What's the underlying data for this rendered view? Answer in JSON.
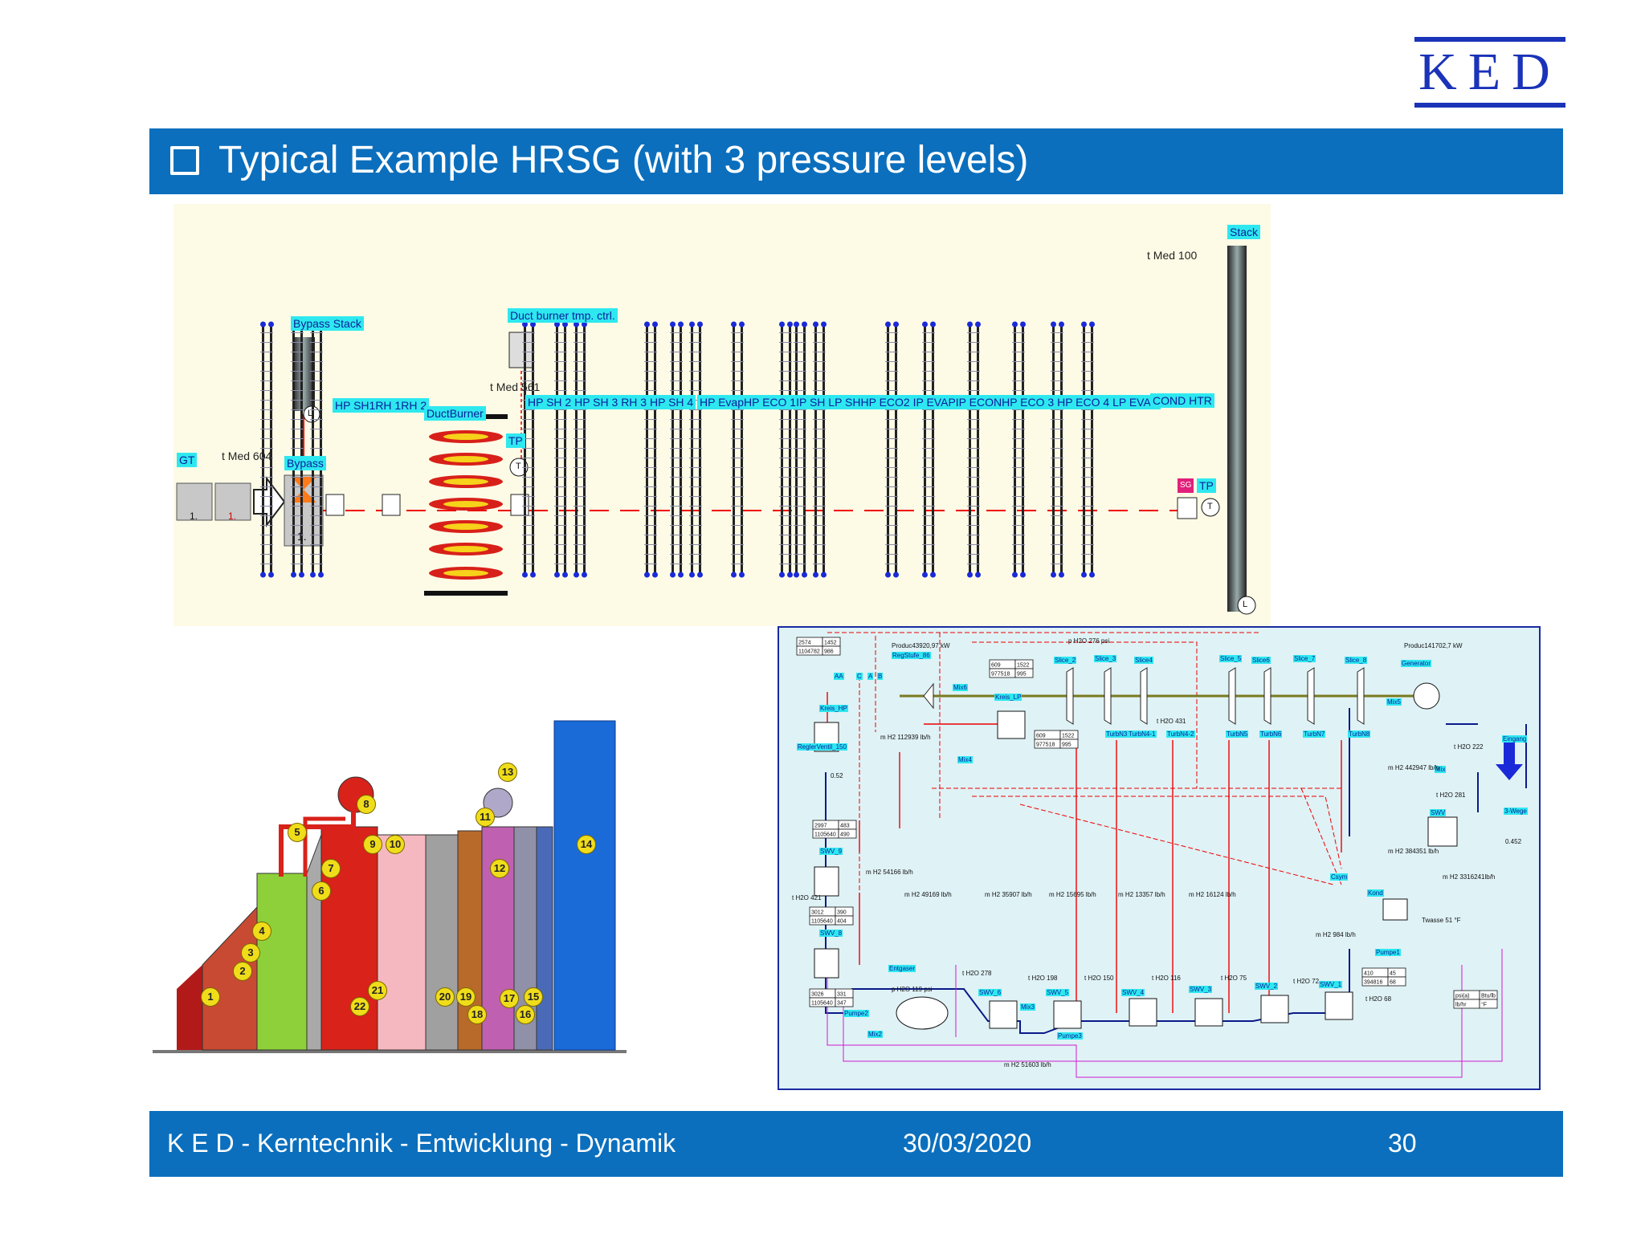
{
  "logo": {
    "text": "KED",
    "color": "#1a33b8"
  },
  "title": {
    "text": "Typical Example HRSG (with 3 pressure levels)",
    "icon": "checkbox-icon"
  },
  "footer": {
    "left": "K E D - Kerntechnik - Entwicklung - Dynamik",
    "date": "30/03/2020",
    "page": "30"
  },
  "colors": {
    "brand_blue": "#0b6fbd",
    "label_cyan": "#2ee8f0",
    "panel_bg": "#fdfbe6",
    "scheme_bg": "#dff2f6"
  },
  "hrsg": {
    "gt": "GT",
    "bypass_stack": "Bypass Stack",
    "bypass": "Bypass",
    "stack": "Stack",
    "duct_burner_ctrl": "Duct burner tmp. ctrl.",
    "duct_burner": "DuctBurner",
    "t_inlet": "t Med  604",
    "t_duct": "t Med   561",
    "t_stack": "t Med   100",
    "sections_a": "HP SH1RH 1RH 2",
    "sections_b": "HP SH 2 HP SH 3 RH 3 HP SH 4",
    "sections_c": "HP EvapHP ECO 1IP SH  LP SHHP ECO2 IP EVAPIP ECONHP ECO 3 HP ECO 4 LP EVAP",
    "cond_htr": "COND HTR",
    "tp1": "TP",
    "tp2": "TP",
    "level_l": "L",
    "t_symbol": "T",
    "gt_labels": [
      "1.",
      "1.",
      "1."
    ],
    "sg": "SG"
  },
  "boiler": {
    "numbers": [
      "1",
      "2",
      "3",
      "4",
      "5",
      "6",
      "7",
      "8",
      "9",
      "10",
      "11",
      "12",
      "13",
      "14",
      "15",
      "16",
      "17",
      "18",
      "19",
      "20",
      "21",
      "22"
    ]
  },
  "scheme": {
    "product1": "Produc43920,97  kW",
    "product2": "Produc141702,7  kW",
    "generator": "Generator",
    "p_h2o_276": "p H2O  276  psi",
    "p_h2o_119": "p H2O  119  psi",
    "slices": [
      "Slice_2",
      "Slice_3",
      "Slice4",
      "Slice_5",
      "Slice6",
      "Slice_7",
      "Slice_8"
    ],
    "turbines": [
      "TurbN3",
      "TurbN4-1",
      "TurbN4-2",
      "TurbN5",
      "TurbN6",
      "TurbN7",
      "TurbN8"
    ],
    "valves": [
      "AA",
      "C",
      "A",
      "B"
    ],
    "regstufe": "RegStufe_86",
    "kreis_hp": "Kreis_HP",
    "kreis_lp": "Kreis_LP",
    "regler": "ReglerVentil_150",
    "mix": [
      "Mix6",
      "Mix4",
      "Mix5",
      "Mix3",
      "Mix2",
      "Mix"
    ],
    "swv": [
      "SWV_9",
      "SWV_8",
      "SWV_6",
      "SWV_5",
      "SWV_4",
      "SWV_3",
      "SWV_2",
      "SWV_1",
      "SWV"
    ],
    "entgaser": "Entgaser",
    "pumpe": [
      "Pumpe2",
      "Pumpe3",
      "Pumpe1"
    ],
    "kond": "Kond",
    "csym": "Csym",
    "tables": [
      [
        [
          "2574",
          "1452"
        ],
        [
          "1104782",
          "986"
        ]
      ],
      [
        [
          "609",
          "1522"
        ],
        [
          "977518",
          "995"
        ]
      ],
      [
        [
          "609",
          "1522"
        ],
        [
          "977518",
          "995"
        ]
      ],
      [
        [
          "2997",
          "483"
        ],
        [
          "1105640",
          "490"
        ]
      ],
      [
        [
          "3012",
          "390"
        ],
        [
          "1105640",
          "404"
        ]
      ],
      [
        [
          "3026",
          "331"
        ],
        [
          "1105640",
          "347"
        ]
      ],
      [
        [
          "410",
          "45"
        ],
        [
          "394816",
          "68"
        ]
      ],
      [
        [
          "psi(a)",
          "Btu/lb"
        ],
        [
          "lb/hr",
          "°F"
        ]
      ]
    ],
    "flows": [
      "m H2  112939  lb/h",
      "m H2  54166  lb/h",
      "m H2  49169  lb/h",
      "m H2  35907  lb/h",
      "m H2  15695  lb/h",
      "m H2  13357  lb/h",
      "m H2  16124  lb/h",
      "m H2  442947  lb/h",
      "m H2  384351  lb/h",
      "m H2  3316241lb/h",
      "m H2  984  lb/h",
      "m H2  51603  lb/h"
    ],
    "temps": [
      "t H2O  421",
      "t H2O  431",
      "t H2O  278",
      "t H2O  198",
      "t H2O  150",
      "t H2O  116",
      "t H2O  75",
      "t H2O  72",
      "t H2O  68",
      "t H2O  222",
      "t H2O  281"
    ],
    "twasse": "Twasse   51    °F",
    "eingang": "Eingang",
    "wegs": "3-Wege",
    "val_052": "0.52",
    "val_0452": "0.452"
  }
}
